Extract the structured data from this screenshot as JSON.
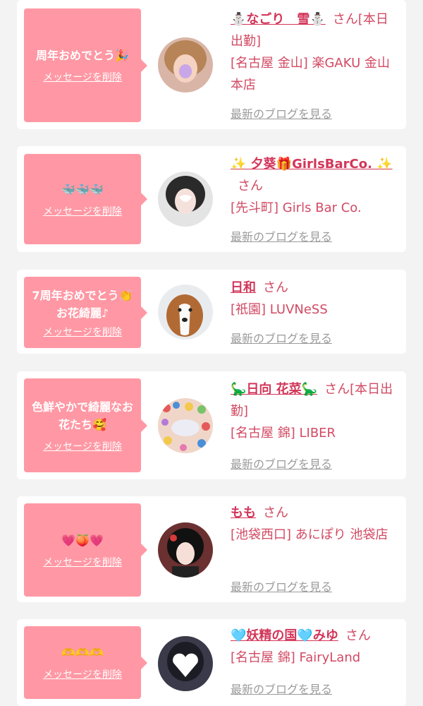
{
  "common": {
    "delete_label": "メッセージを削除",
    "san": "さん",
    "blog_link": "最新のブログを見る"
  },
  "cards": [
    {
      "message": "周年おめでとう🎉",
      "name": "⛄なごり　雪⛄",
      "status": "[本日出勤]",
      "shop": "[名古屋 金山] 楽GAKU 金山本店",
      "avatar_icon": "girl-photo-avatar"
    },
    {
      "message": "🐳🐳🐳",
      "name": "✨ 夕葵🎁GirlsBarCo. ✨",
      "status": "",
      "shop": "[先斗町] Girls Bar Co.",
      "avatar_icon": "girl-photo-avatar"
    },
    {
      "message": "7周年おめでとう👏お花綺麗♪",
      "name": "日和",
      "status": "",
      "shop": "[祇園] LUVNeSS",
      "avatar_icon": "dog-photo-avatar"
    },
    {
      "message": "色鮮やかで綺麗なお花たち🥰",
      "name": "🦕日向 花菜🦕",
      "status": "[本日出勤]",
      "shop": "[名古屋 錦] LIBER",
      "avatar_icon": "ballpit-photo-avatar"
    },
    {
      "message": "💗🍑💗",
      "name": "もも",
      "status": "",
      "shop": "[池袋西口] あにぽり 池袋店",
      "avatar_icon": "girl-photo-avatar"
    },
    {
      "message": "🫶🫶🫶",
      "name": "🩵妖精の国🩵みゆ",
      "status": "",
      "shop": "[名古屋 錦] FairyLand",
      "avatar_icon": "girl-photo-avatar"
    }
  ],
  "colors": {
    "page_bg": "#f3f3f3",
    "card_bg": "#ffffff",
    "bubble_bg": "#ff98a4",
    "name_color": "#d2365a",
    "link_gray": "#9b9b9b"
  }
}
